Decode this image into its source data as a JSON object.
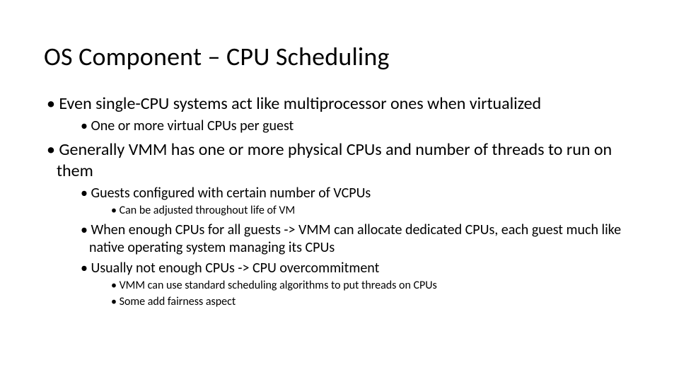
{
  "title": "OS Component – CPU Scheduling",
  "bullets": [
    {
      "text": "Even single-CPU systems act like multiprocessor ones when virtualized",
      "children": [
        {
          "text": "One or more virtual CPUs per guest",
          "children": []
        }
      ]
    },
    {
      "text": "Generally VMM has one or more physical CPUs and number of threads to run on them",
      "children": [
        {
          "text": "Guests configured with certain number of VCPUs",
          "children": [
            {
              "text": "Can be adjusted throughout life of VM",
              "children": []
            }
          ]
        },
        {
          "text": "When enough CPUs for all guests -> VMM can allocate dedicated CPUs, each guest much like native operating system managing its CPUs",
          "children": []
        },
        {
          "text": "Usually not enough CPUs -> CPU overcommitment",
          "children": [
            {
              "text": "VMM can use standard scheduling algorithms to put threads on CPUs",
              "children": []
            },
            {
              "text": "Some add fairness aspect",
              "children": []
            }
          ]
        }
      ]
    }
  ]
}
